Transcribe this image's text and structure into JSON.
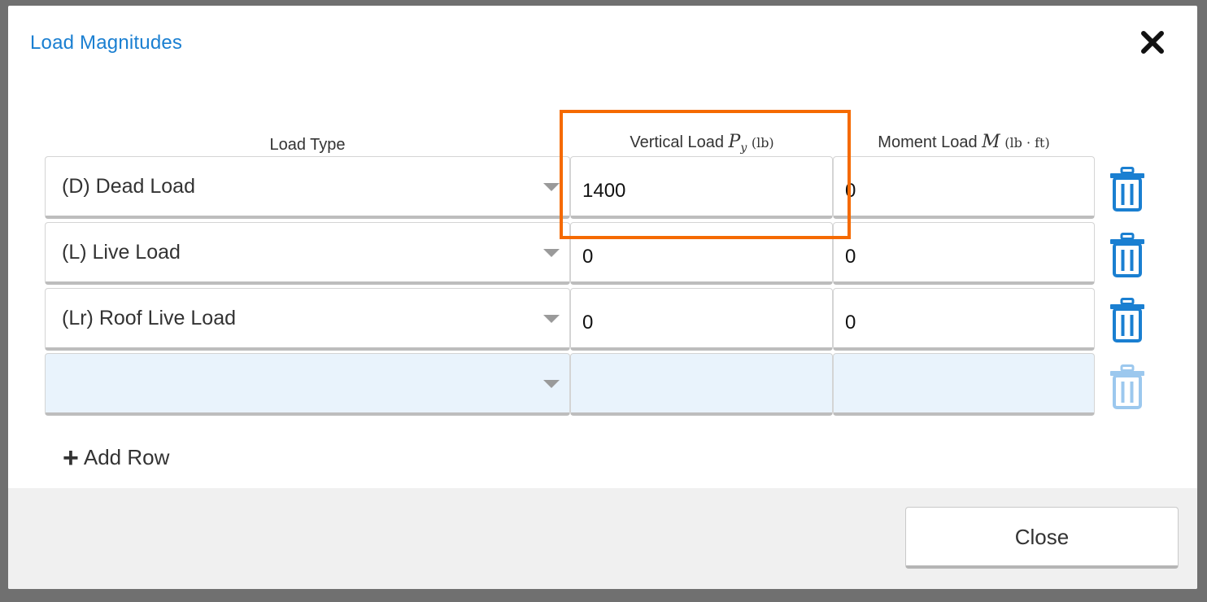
{
  "dialog": {
    "title": "Load Magnitudes",
    "close_icon": "close-icon"
  },
  "columns": {
    "load_type": "Load Type",
    "vertical": {
      "label": "Vertical Load",
      "symbol": "P",
      "subscript": "y",
      "unit": "(lb)"
    },
    "moment": {
      "label": "Moment Load",
      "symbol": "M",
      "unit": "(lb · ft)"
    }
  },
  "rows": [
    {
      "load_type": "(D) Dead Load",
      "vertical": "1400",
      "moment": "0"
    },
    {
      "load_type": "(L) Live Load",
      "vertical": "0",
      "moment": "0"
    },
    {
      "load_type": "(Lr) Roof Live Load",
      "vertical": "0",
      "moment": "0"
    },
    {
      "load_type": "",
      "vertical": "",
      "moment": ""
    }
  ],
  "add_row_label": "Add Row",
  "footer": {
    "close_label": "Close"
  },
  "colors": {
    "accent": "#1a7fd1",
    "trash_active": "#1a7fd1",
    "trash_disabled": "#9cc8ee",
    "highlight": "#f56a00",
    "empty_row": "#e9f3fc"
  }
}
